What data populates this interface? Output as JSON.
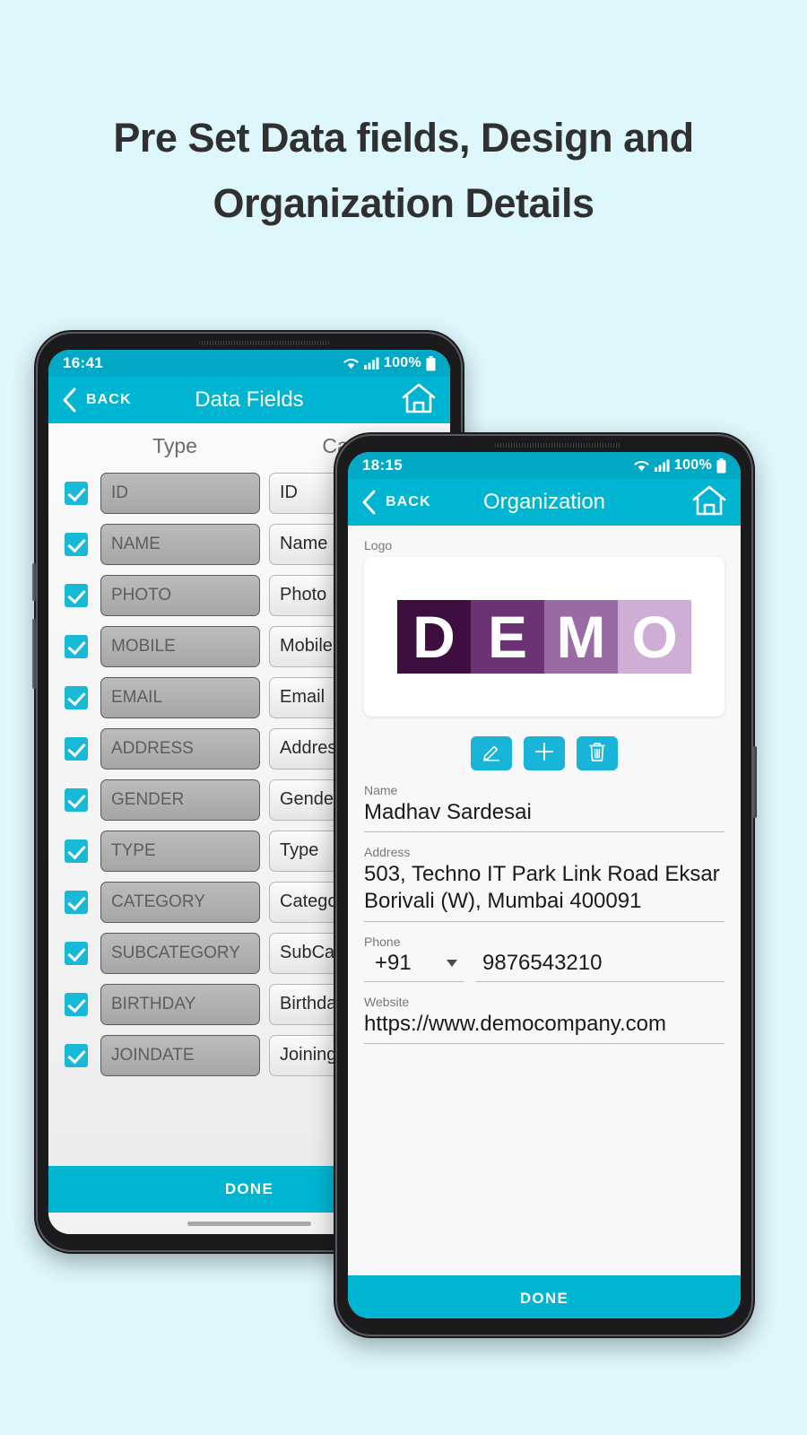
{
  "headline": "Pre Set Data fields, Design and Organization Details",
  "theme": {
    "page_bg": "#ddf7fd",
    "accent": "#00b5d2",
    "status_bar": "#01a9c4",
    "checkbox": "#17b8d8",
    "action_button": "#19b5d8"
  },
  "left_phone": {
    "status": {
      "time": "16:41",
      "wifi_icon": "wifi-icon",
      "signal_icon": "signal-icon",
      "battery_text": "100%",
      "battery_icon": "battery-icon"
    },
    "appbar": {
      "back_icon": "chevron-left-icon",
      "back_label": "BACK",
      "title": "Data Fields",
      "home_icon": "home-icon"
    },
    "columns": {
      "type": "Type",
      "caption": "Caption"
    },
    "rows": [
      {
        "checked": true,
        "type": "ID",
        "caption": "ID"
      },
      {
        "checked": true,
        "type": "NAME",
        "caption": "Name"
      },
      {
        "checked": true,
        "type": "PHOTO",
        "caption": "Photo"
      },
      {
        "checked": true,
        "type": "MOBILE",
        "caption": "Mobile"
      },
      {
        "checked": true,
        "type": "EMAIL",
        "caption": "Email"
      },
      {
        "checked": true,
        "type": "ADDRESS",
        "caption": "Address"
      },
      {
        "checked": true,
        "type": "GENDER",
        "caption": "Gender"
      },
      {
        "checked": true,
        "type": "TYPE",
        "caption": "Type"
      },
      {
        "checked": true,
        "type": "CATEGORY",
        "caption": "Category"
      },
      {
        "checked": true,
        "type": "SUBCATEGORY",
        "caption": "SubCategory"
      },
      {
        "checked": true,
        "type": "BIRTHDAY",
        "caption": "Birthday"
      },
      {
        "checked": true,
        "type": "JOINDATE",
        "caption": "Joining Date"
      }
    ],
    "done_label": "DONE"
  },
  "right_phone": {
    "status": {
      "time": "18:15",
      "wifi_icon": "wifi-icon",
      "signal_icon": "signal-icon",
      "battery_text": "100%",
      "battery_icon": "battery-icon"
    },
    "appbar": {
      "back_icon": "chevron-left-icon",
      "back_label": "BACK",
      "title": "Organization",
      "home_icon": "home-icon"
    },
    "logo": {
      "label": "Logo",
      "letters": [
        "D",
        "E",
        "M",
        "O"
      ],
      "colors": [
        "#3d0e3f",
        "#6b3274",
        "#9a6aa4",
        "#cfaed6"
      ]
    },
    "actions": [
      {
        "name": "edit-logo-button",
        "icon": "pencil-icon"
      },
      {
        "name": "add-logo-button",
        "icon": "plus-icon"
      },
      {
        "name": "delete-logo-button",
        "icon": "trash-icon"
      }
    ],
    "fields": {
      "name_label": "Name",
      "name_value": "Madhav Sardesai",
      "address_label": "Address",
      "address_value": "503, Techno IT Park Link Road Eksar Borivali (W), Mumbai 400091",
      "phone_label": "Phone",
      "phone_country_code": "+91",
      "phone_value": "9876543210",
      "website_label": "Website",
      "website_value": "https://www.democompany.com"
    },
    "done_label": "DONE"
  }
}
